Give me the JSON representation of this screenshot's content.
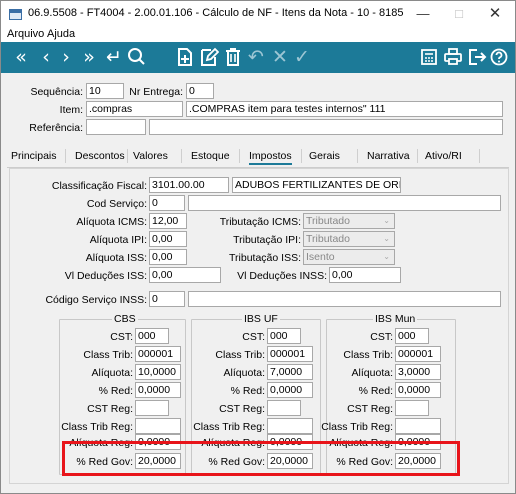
{
  "window": {
    "title": "06.9.5508 - FT4004 - 2.00.01.106 - Cálculo de NF - Itens da Nota - 10 - 8185"
  },
  "menu": [
    {
      "label": "Arquivo"
    },
    {
      "label": "Ajuda"
    }
  ],
  "toolbar": {
    "accent": "#1c7a98",
    "icons": [
      "first-icon",
      "previous-icon",
      "next-icon",
      "last-icon",
      "return-icon",
      "search-icon",
      "new-icon",
      "edit-icon",
      "delete-icon",
      "undo-icon",
      "cancel-icon",
      "confirm-icon",
      "calculator-icon",
      "print-icon",
      "exit-icon",
      "help-icon"
    ]
  },
  "header": {
    "sequencia": {
      "label": "Sequência:",
      "value": "10"
    },
    "nr_entrega": {
      "label": "Nr Entrega:",
      "value": "0"
    },
    "item": {
      "label": "Item:",
      "code": ".compras",
      "description": ".COMPRAS item para testes internos\" 111"
    },
    "referencia": {
      "label": "Referência:",
      "value": ""
    }
  },
  "tabs": [
    {
      "label": "Principais"
    },
    {
      "label": "Descontos"
    },
    {
      "label": "Valores"
    },
    {
      "label": "Estoque"
    },
    {
      "label": "Impostos",
      "active": true
    },
    {
      "label": "Gerais"
    },
    {
      "label": "Narrativa"
    },
    {
      "label": "Ativo/RI"
    }
  ],
  "impostos": {
    "classificacao_fiscal": {
      "label": "Classificação Fiscal:",
      "code": "3101.00.00",
      "description": "ADUBOS FERTILIZANTES DE ORIGEM ANIM"
    },
    "cod_servico": {
      "label": "Cod Serviço:",
      "value": "0"
    },
    "aliquota_icms": {
      "label": "Alíquota ICMS:",
      "value": "12,00"
    },
    "tributacao_icms": {
      "label": "Tributação ICMS:",
      "value": "Tributado"
    },
    "aliquota_ipi": {
      "label": "Alíquota IPI:",
      "value": "0,00"
    },
    "tributacao_ipi": {
      "label": "Tributação IPI:",
      "value": "Tributado"
    },
    "aliquota_iss": {
      "label": "Alíquota ISS:",
      "value": "0,00"
    },
    "tributacao_iss": {
      "label": "Tributação ISS:",
      "value": "Isento"
    },
    "vl_deducoes_iss": {
      "label": "Vl Deduções ISS:",
      "value": "0,00"
    },
    "vl_deducoes_inss": {
      "label": "Vl Deduções INSS:",
      "value": "0,00"
    },
    "codigo_servico_inss": {
      "label": "Código Serviço INSS:",
      "value": "0"
    }
  },
  "groups": [
    {
      "title": "CBS",
      "cst_label": "CST:",
      "cst": "000",
      "class_trib_label": "Class Trib:",
      "class_trib": "000001",
      "aliquota_label": "Alíquota:",
      "aliquota": "10,0000",
      "red_label": "% Red:",
      "red": "0,0000",
      "cst_reg_label": "CST Reg:",
      "class_trib_reg_label": "Class Trib Reg:",
      "aliquota_reg_label": "Alíquota Reg:",
      "aliquota_reg": "0,0000",
      "red_gov_label": "% Red Gov:",
      "red_gov": "20,0000"
    },
    {
      "title": "IBS UF",
      "cst_label": "CST:",
      "cst": "000",
      "class_trib_label": "Class Trib:",
      "class_trib": "000001",
      "aliquota_label": "Alíquota:",
      "aliquota": "7,0000",
      "red_label": "% Red:",
      "red": "0,0000",
      "cst_reg_label": "CST Reg:",
      "class_trib_reg_label": "Class Trib Reg:",
      "aliquota_reg_label": "Alíquota Reg:",
      "aliquota_reg": "0,0000",
      "red_gov_label": "% Red Gov:",
      "red_gov": "20,0000"
    },
    {
      "title": "IBS Mun",
      "cst_label": "CST:",
      "cst": "000",
      "class_trib_label": "Class Trib:",
      "class_trib": "000001",
      "aliquota_label": "Alíquota:",
      "aliquota": "3,0000",
      "red_label": "% Red:",
      "red": "0,0000",
      "cst_reg_label": "CST Reg:",
      "class_trib_reg_label": "Class Trib Reg:",
      "aliquota_reg_label": "Alíquota Reg:",
      "aliquota_reg": "0,0000",
      "red_gov_label": "% Red Gov:",
      "red_gov": "20,0000"
    }
  ],
  "highlight_color": "#e8141a"
}
